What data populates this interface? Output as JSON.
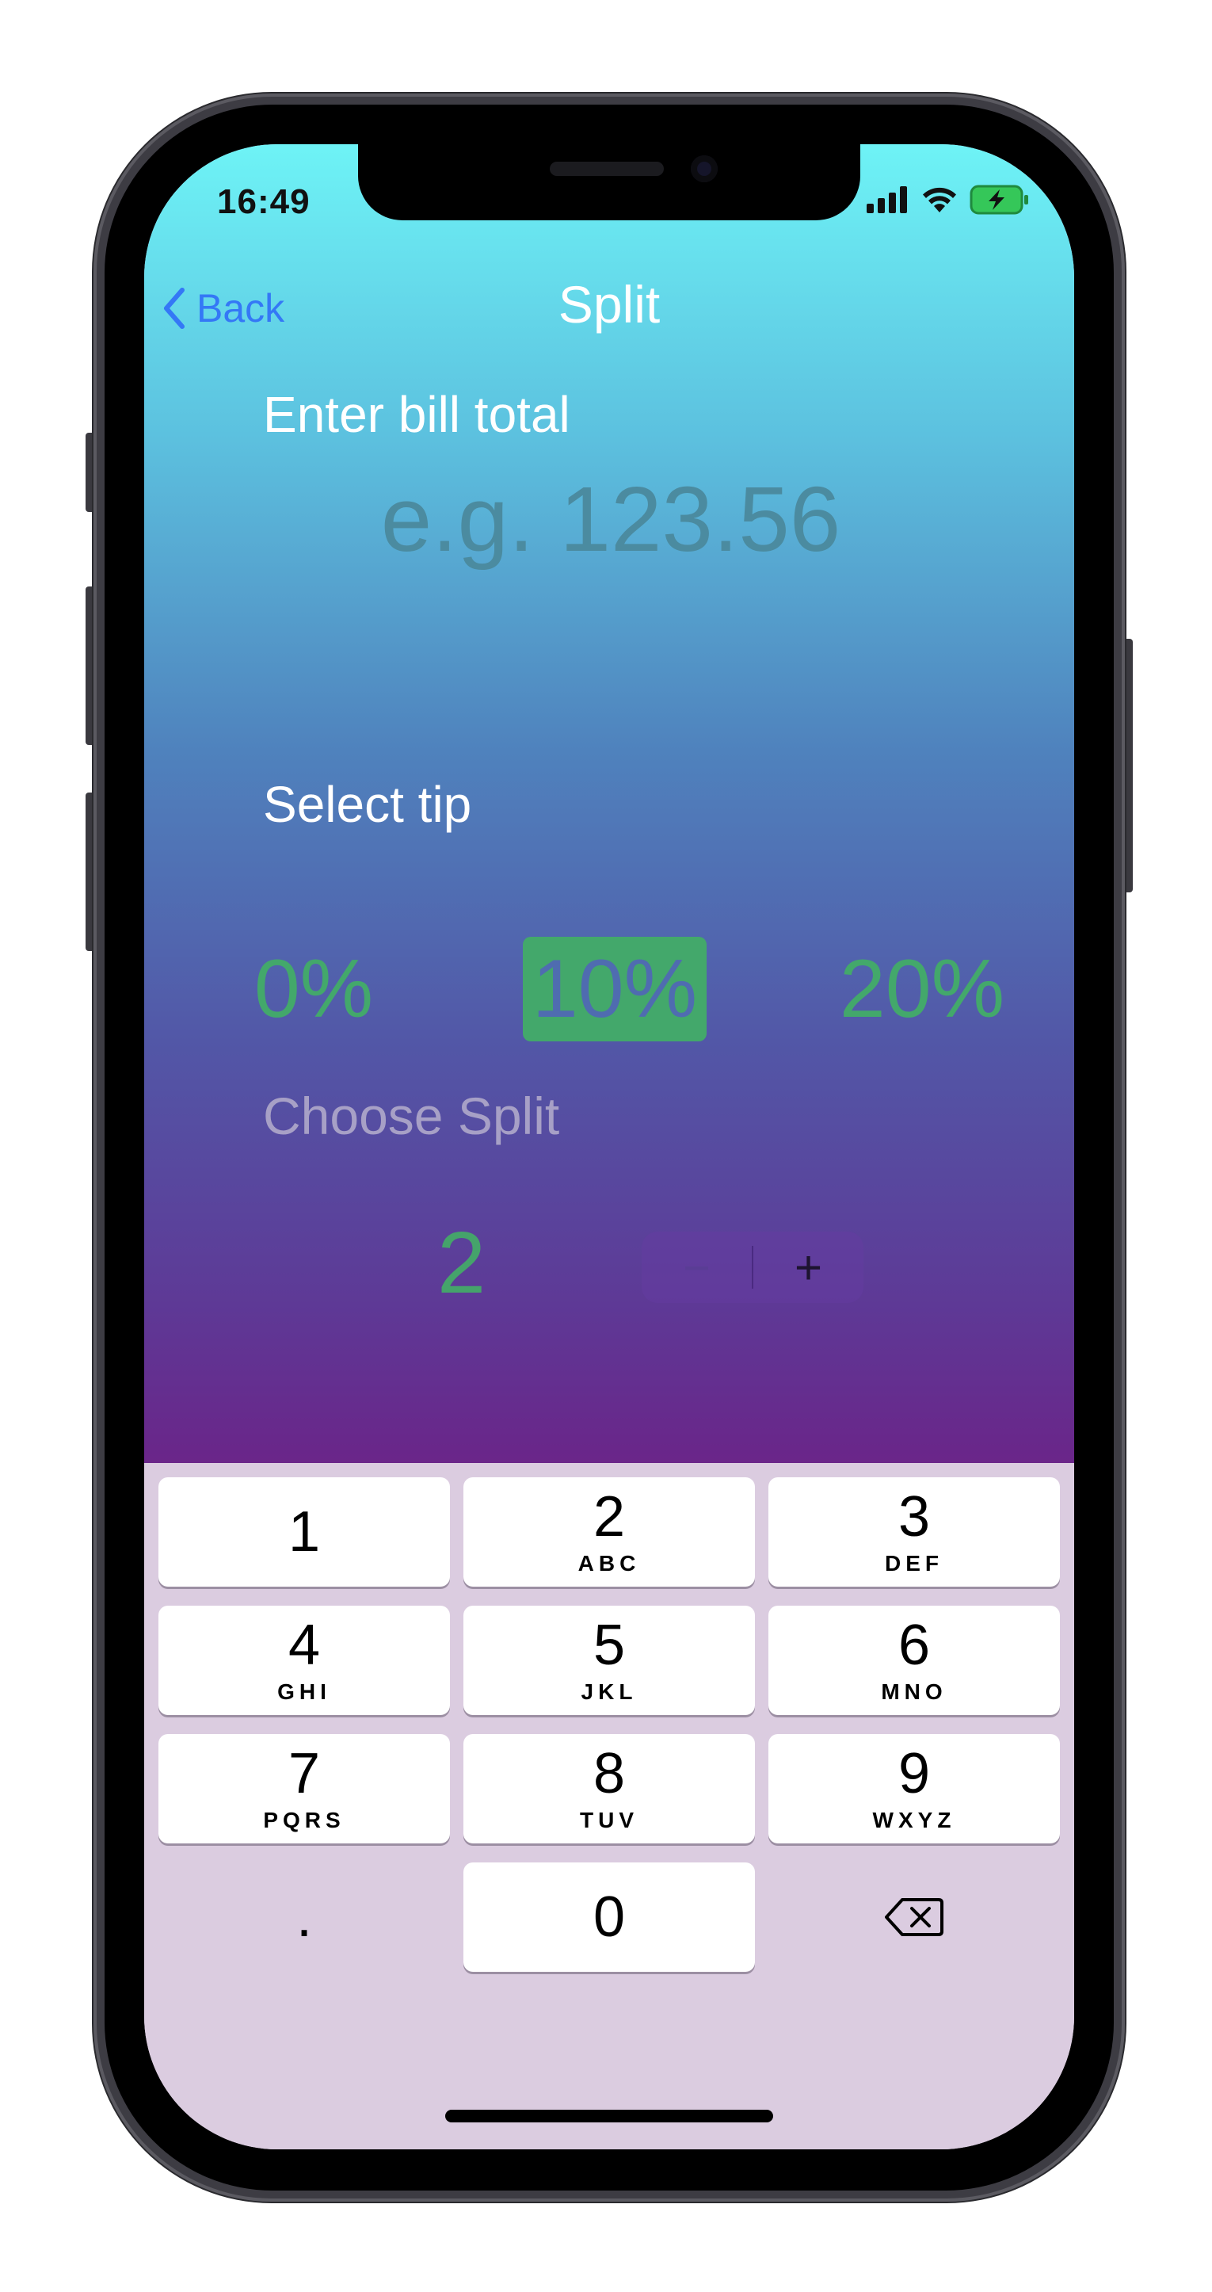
{
  "status_bar": {
    "time": "16:49",
    "signal_icon": "cellular-signal-icon",
    "wifi_icon": "wifi-icon",
    "battery_icon": "battery-charging-icon",
    "battery_color": "#35c759"
  },
  "nav": {
    "back_label": "Back",
    "title": "Split",
    "back_color": "#3478f6"
  },
  "bill": {
    "label": "Enter bill total",
    "placeholder": "e.g. 123.56",
    "value": ""
  },
  "tip": {
    "label": "Select tip",
    "options": [
      "0%",
      "10%",
      "20%"
    ],
    "selected": "10%",
    "accent_color": "#43a86b"
  },
  "split": {
    "label": "Choose Split",
    "value": "2",
    "minus_label": "−",
    "plus_label": "+"
  },
  "keypad": {
    "keys": [
      {
        "num": "1",
        "letters": ""
      },
      {
        "num": "2",
        "letters": "ABC"
      },
      {
        "num": "3",
        "letters": "DEF"
      },
      {
        "num": "4",
        "letters": "GHI"
      },
      {
        "num": "5",
        "letters": "JKL"
      },
      {
        "num": "6",
        "letters": "MNO"
      },
      {
        "num": "7",
        "letters": "PQRS"
      },
      {
        "num": "8",
        "letters": "TUV"
      },
      {
        "num": "9",
        "letters": "WXYZ"
      },
      {
        "num": ".",
        "letters": ""
      },
      {
        "num": "0",
        "letters": ""
      },
      {
        "num": "",
        "letters": ""
      }
    ],
    "delete_icon": "delete-backspace-icon"
  }
}
